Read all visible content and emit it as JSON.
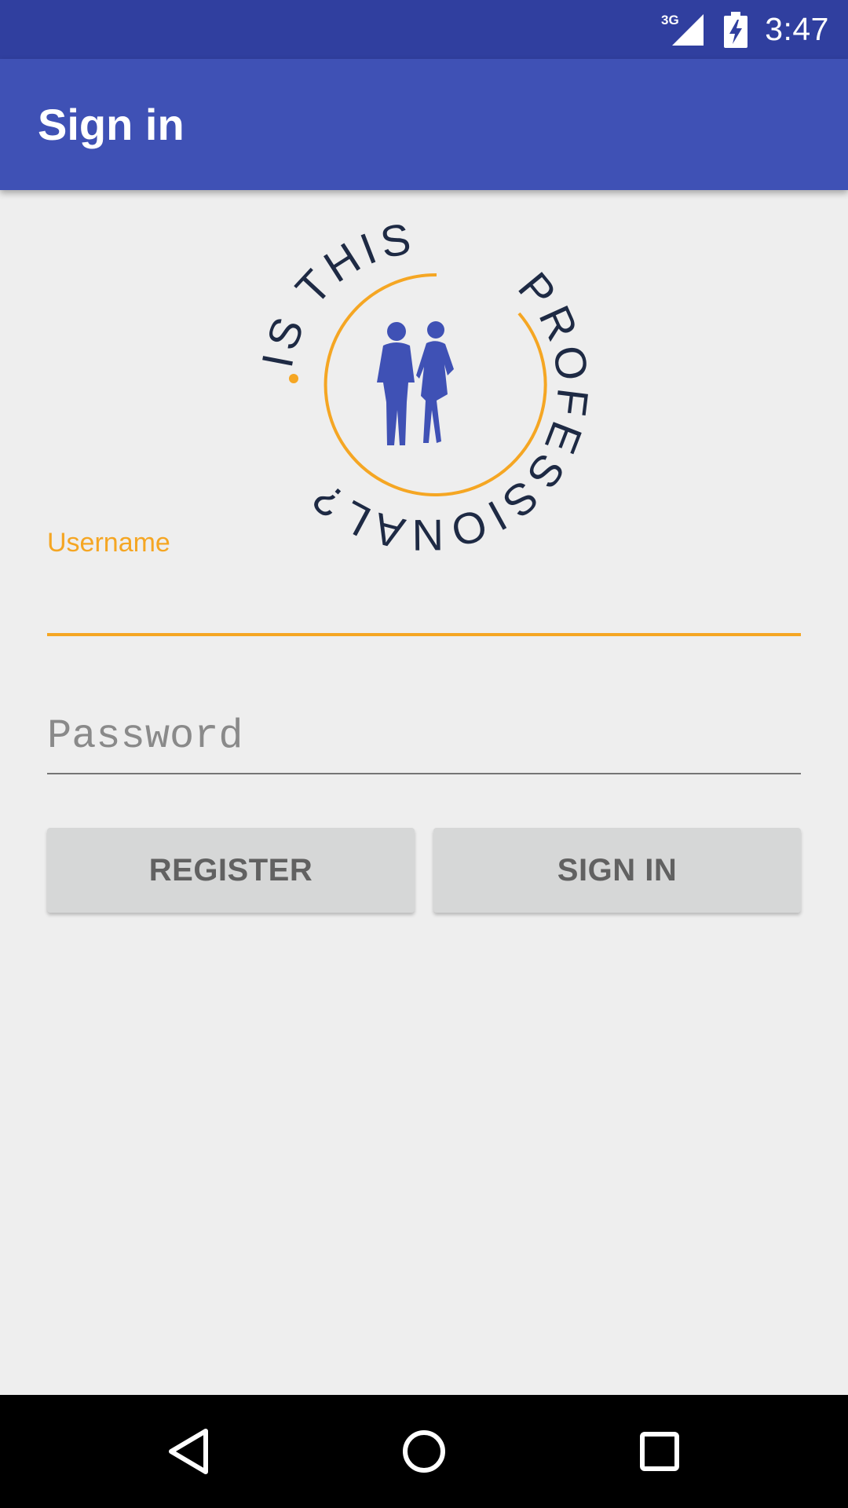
{
  "status_bar": {
    "network": "3G",
    "time": "3:47",
    "icons": [
      "signal-3g-icon",
      "battery-charging-icon"
    ]
  },
  "app_bar": {
    "title": "Sign in"
  },
  "logo": {
    "text_top": "IS THIS",
    "text_right": "PROFESSIONAL?",
    "icon": "professionals-silhouette-icon"
  },
  "form": {
    "username_label": "Username",
    "username_value": "",
    "password_placeholder": "Password",
    "password_value": ""
  },
  "buttons": {
    "register": "REGISTER",
    "sign_in": "SIGN IN"
  },
  "nav_bar": {
    "icons": [
      "back-icon",
      "home-icon",
      "recents-icon"
    ]
  },
  "colors": {
    "status_bar": "#303f9f",
    "app_bar": "#3f51b5",
    "accent": "#f5a623",
    "logo_text": "#1e2a44",
    "silhouette": "#3f51b5"
  }
}
